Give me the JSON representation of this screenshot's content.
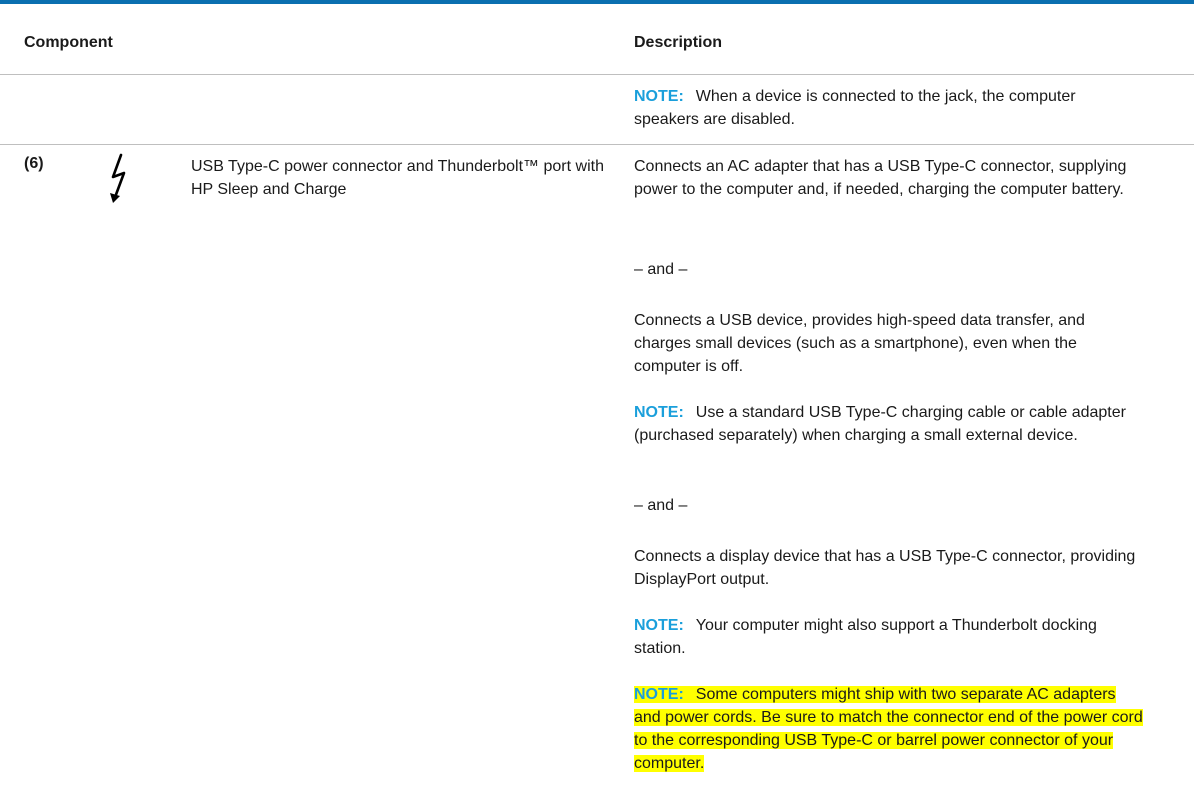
{
  "table": {
    "headers": {
      "component": "Component",
      "description": "Description"
    },
    "note_row": {
      "note_label": "NOTE:",
      "note_text": "When a device is connected to the jack, the computer speakers are disabled."
    },
    "row6": {
      "number": "(6)",
      "icon": "lightning-bolt-icon",
      "component": "USB Type-C power connector and Thunderbolt™ port with HP Sleep and Charge",
      "desc": {
        "p1": "Connects an AC adapter that has a USB Type-C connector, supplying power to the computer and, if needed, charging the computer battery.",
        "and1": "– and –",
        "p2": "Connects a USB device, provides high-speed data transfer, and charges small devices (such as a smartphone), even when the computer is off.",
        "note1_label": "NOTE:",
        "note1_text": "Use a standard USB Type-C charging cable or cable adapter (purchased separately) when charging a small external device.",
        "and2": "– and –",
        "p3": "Connects a display device that has a USB Type-C connector, providing DisplayPort output.",
        "note2_label": "NOTE:",
        "note2_text": "Your computer might also support a Thunderbolt docking station.",
        "note3_label": "NOTE:",
        "note3_text": "Some computers might ship with two separate AC adapters and power cords. Be sure to match the connector end of the power cord to the corresponding USB Type-C or barrel power connector of your computer."
      }
    }
  },
  "colors": {
    "rule": "#0a6fb0",
    "note": "#1a9fdb",
    "highlight": "#ffff00"
  }
}
